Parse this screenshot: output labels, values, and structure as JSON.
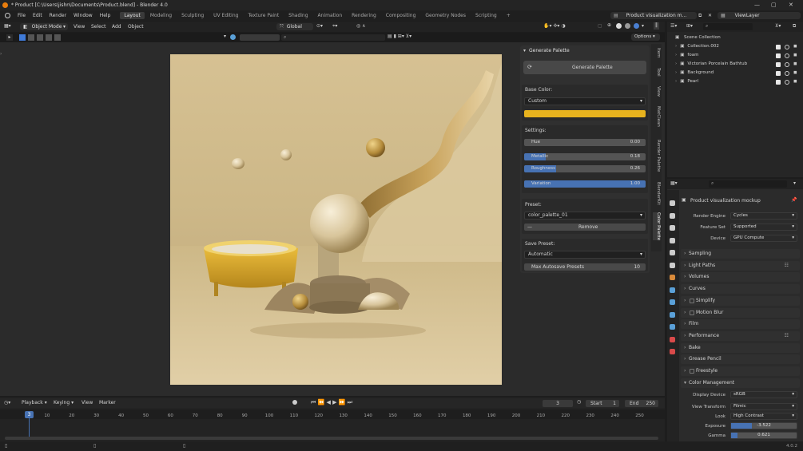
{
  "window": {
    "title": "* Product [C:\\Users\\jishn\\Documents\\Product.blend] - Blender 4.0",
    "version": "4.0.2"
  },
  "menu": {
    "items": [
      "File",
      "Edit",
      "Render",
      "Window",
      "Help"
    ]
  },
  "workspaces": [
    "Layout",
    "Modeling",
    "Sculpting",
    "UV Editing",
    "Texture Paint",
    "Shading",
    "Animation",
    "Rendering",
    "Compositing",
    "Geometry Nodes",
    "Scripting"
  ],
  "scene": {
    "name": "Product visualization m...",
    "view_layer": "ViewLayer"
  },
  "viewport_header": {
    "mode": "Object Mode",
    "menus": [
      "View",
      "Select",
      "Add",
      "Object"
    ],
    "transform": "Global",
    "options": "Options"
  },
  "npanel": {
    "header": "Generate Palette",
    "generate_btn": "Generate Palette",
    "base_color_label": "Base Color:",
    "base_color_value": "Custom",
    "swatch_color": "#e8b31e",
    "settings_label": "Settings:",
    "sliders": [
      {
        "label": "Hue",
        "value": "0.00",
        "frac": 0.0
      },
      {
        "label": "Metallic",
        "value": "0.18",
        "frac": 0.18
      },
      {
        "label": "Roughness",
        "value": "0.26",
        "frac": 0.26
      },
      {
        "label": "Variation",
        "value": "1.00",
        "frac": 1.0
      }
    ],
    "preset_label": "Preset:",
    "preset_value": "color_palette_01",
    "remove_btn": "Remove",
    "save_preset_label": "Save Preset:",
    "save_preset_value": "Automatic",
    "max_autosave_label": "Max Autosave Presets",
    "max_autosave_value": "10",
    "tabs": [
      "Item",
      "Tool",
      "View",
      "MatClean",
      "Render Palette",
      "BlenderKit",
      "Color Palette"
    ]
  },
  "outliner": {
    "root": "Scene Collection",
    "items": [
      "Collection.002",
      "foam",
      "Victorian Porcelain Bathtub",
      "Background",
      "Pearl"
    ]
  },
  "properties": {
    "title": "Product visualization mockup",
    "render_engine_label": "Render Engine",
    "render_engine": "Cycles",
    "feature_set_label": "Feature Set",
    "feature_set": "Supported",
    "device_label": "Device",
    "device": "GPU Compute",
    "sections": [
      "Sampling",
      "Light Paths",
      "Volumes",
      "Curves",
      "Simplify",
      "Motion Blur",
      "Film",
      "Performance",
      "Bake",
      "Grease Pencil",
      "Freestyle",
      "Color Management"
    ],
    "display_device_label": "Display Device",
    "display_device": "sRGB",
    "view_transform_label": "View Transform",
    "view_transform": "Filmic",
    "look_label": "Look",
    "look": "High Contrast",
    "exposure_label": "Exposure",
    "exposure": "-3.522",
    "gamma_label": "Gamma",
    "gamma": "0.621"
  },
  "timeline": {
    "menus": [
      "Playback",
      "Keying",
      "View",
      "Marker"
    ],
    "current_frame": "3",
    "start_label": "Start",
    "start": "1",
    "end_label": "End",
    "end": "250",
    "ticks": [
      "10",
      "20",
      "30",
      "40",
      "50",
      "60",
      "70",
      "80",
      "90",
      "100",
      "110",
      "120",
      "130",
      "140",
      "150",
      "160",
      "170",
      "180",
      "190",
      "200",
      "210",
      "220",
      "230",
      "240",
      "250"
    ]
  }
}
